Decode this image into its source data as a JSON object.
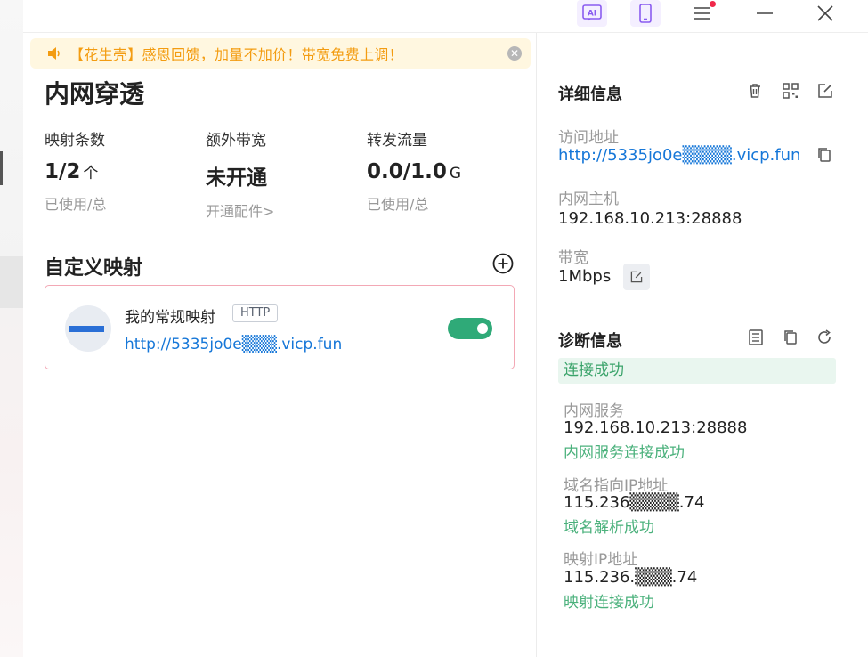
{
  "titlebar": {
    "ai_label": "AI"
  },
  "notice": {
    "text": "【花生壳】感恩回馈，加量不加价！带宽免费上调！"
  },
  "page": {
    "title": "内网穿透"
  },
  "stats": [
    {
      "label": "映射条数",
      "value": "1/2",
      "unit": "个",
      "sub": "已使用/总"
    },
    {
      "label": "额外带宽",
      "value": "未开通",
      "unit": "",
      "sub": "开通配件>"
    },
    {
      "label": "转发流量",
      "value": "0.0/1.0",
      "unit": "G",
      "sub": "已使用/总"
    }
  ],
  "custom_mapping": {
    "title": "自定义映射",
    "items": [
      {
        "name": "我的常规映射",
        "protocol": "HTTP",
        "url": "http://5335jo0e▒▒▒.vicp.fun",
        "enabled": true
      }
    ]
  },
  "details": {
    "title": "详细信息",
    "access_label": "访问地址",
    "access_url": "http://5335jo0e▒▒▒▒.vicp.fun",
    "host_label": "内网主机",
    "host_value": "192.168.10.213:28888",
    "bandwidth_label": "带宽",
    "bandwidth_value": "1Mbps"
  },
  "diagnostics": {
    "title": "诊断信息",
    "status": "连接成功",
    "items": [
      {
        "label": "内网服务",
        "value": "192.168.10.213:28888",
        "status": "内网服务连接成功"
      },
      {
        "label": "域名指向IP地址",
        "value": "115.236▒▒▒▒.74",
        "status": "域名解析成功"
      },
      {
        "label": "映射IP地址",
        "value": "115.236.▒▒▒.74",
        "status": "映射连接成功"
      }
    ]
  },
  "colors": {
    "accent_link": "#1677d8",
    "success": "#3aa36a",
    "notice_text": "#f39c11",
    "toggle_on": "#2faa78"
  }
}
